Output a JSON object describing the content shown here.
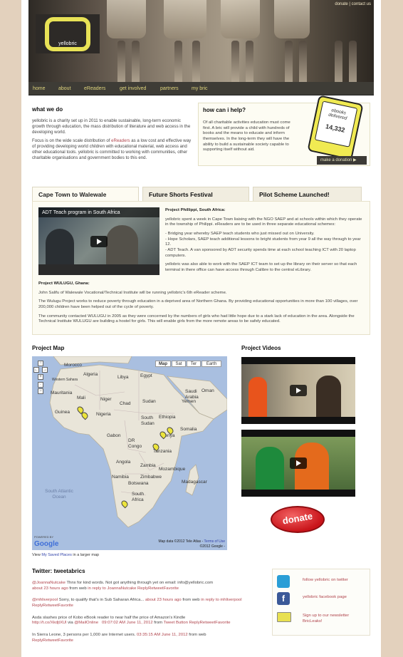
{
  "header": {
    "top_links": [
      "donate",
      "contact us"
    ],
    "top_sep": " | ",
    "logo_text": "yellobric"
  },
  "nav": {
    "items": [
      "home",
      "about",
      "eReaders",
      "get involved",
      "partners",
      "my bric"
    ]
  },
  "what_we_do": {
    "title": "what we do",
    "p1": "yellobric is a charity set up in 2011 to enable sustainable, long-term economic growth through education, the mass distribution of literature and web access in the developing world.",
    "p2_before": "Focus is on the wide scale distribution of ",
    "p2_link": "eReaders",
    "p2_after": " as a low cost and effective way of providing developing world children with educational material, web access and other educational tools. yellobric is committed to working with communities, other charitable organisations and government bodies to this end."
  },
  "how_help": {
    "title": "how can i help?",
    "text": "Of all charitable activities education must come first. A bric will provide a child with hundreds of books and the means to educate and inform themselves. In the long-term they will have the ability to build a sustainable society capable to supporting itself without aid.",
    "reader_label": "ebooks delivered",
    "reader_count": "14,332",
    "donate_button": "make a donation  ▶"
  },
  "tabs": [
    "Cape Town to Walewale",
    "Future Shorts Festival",
    "Pilot Scheme Launched!"
  ],
  "panel": {
    "video_title": "ADT Teach program in South Africa",
    "project1_title": "Project Phillippi, South Africa:",
    "project1_p1": "yellobric spent a week in Cape Town liaising with the NGO SAEP and at schools within which they operate in the township of Philippi. eReaders are to be used in three separate educational schemes:",
    "project1_list": "- Bridging year whereby SAEP teach students who just missed out on University.\n- Hope Scholars, SAEP teach additional lessons to bright students from year 9 all the way through to year 12.\n- ADT Teach. A van sponsored by ADT security spends time at each school teaching ICT with 20 laptop computers.",
    "project1_p2": "yellobric was also able to work with the SAEP ICT team to set up the library on their server so that each terminal in there office can have access through Calibre to the central eLibrary.",
    "project2_title": "Project WULUGU, Ghana:",
    "project2_p1": "John Salifu of Walewale Vocational/Technical Institute will be running yellobric's 6th eReader scheme.",
    "project2_p2": "The Wulugu Project works to reduce poverty through education in a deprived area of Northern Ghana. By providing educational opportunities in more than 100 villages, over 200,000 children have been helped out of the cycle of poverty.",
    "project2_p3": "The community contacted WULUGU in 2005 as they were concerned by the numbers of girls who had little hope due to a stark lack of education in the area. Alongside the Technical Institute WULUGU are building a hostel for girls. This will enable girls from the more remote areas to be safely educated."
  },
  "project_map": {
    "title": "Project Map",
    "buttons": [
      "Map",
      "Sat",
      "Ter",
      "Earth"
    ],
    "labels": [
      "Morocco",
      "Algeria",
      "Libya",
      "Egypt",
      "Mauritania",
      "Mali",
      "Niger",
      "Chad",
      "Sudan",
      "Guinea",
      "Nigeria",
      "Ethiopia",
      "South Sudan",
      "Somalia",
      "Kenya",
      "Gabon",
      "DR Congo",
      "Tanzania",
      "Angola",
      "Zambia",
      "Namibia",
      "Zimbabwe",
      "Mozambique",
      "Botswana",
      "Madagascar",
      "South Africa",
      "Saudi Arabia",
      "Yemen",
      "Oman",
      "South Atlantic Ocean",
      "Western Sahara"
    ],
    "copyright": "©2012 Google -",
    "map_data": "Map data ©2012 Tele Atlas - ",
    "terms": "Terms of Use",
    "google": "Google",
    "powered": "POWERED BY",
    "note_before": "View ",
    "note_link": "My Saved Places",
    "note_after": " in a larger map"
  },
  "project_videos": {
    "title": "Project Videos"
  },
  "donate_button": "donate",
  "twitter": {
    "title": "Twitter: tweetabrics",
    "tweets": [
      {
        "user": "@JoannaNutcake",
        "text": " Thnx for kind words. Not got anything through yet on email: info@yellobric.com",
        "meta": "about 23 hours ago",
        "from": " from web ",
        "reply": "in reply to JoannaNutcake ReplyRetweetFavorite"
      },
      {
        "user": "@mhliverpool",
        "text": " Sorry, to qualify that's in Sub Saharan Africa...",
        "meta": "about 23 hours ago",
        "from": " from web ",
        "reply": "in reply to mhliverpool ReplyRetweetFavorite"
      },
      {
        "user": "",
        "text": "Asda slashes price of Kobo eBook reader to near half the price of Amazon's Kindle ",
        "link": "http://t.co/XkdjtXUl",
        "via": " via ",
        "via_user": "@MailOnline",
        "meta": "09:07:02 AM June 11, 2012",
        "from": " from ",
        "reply": "Tweet Button ReplyRetweetFavorite"
      },
      {
        "user": "",
        "text": "In Sierra Leone, 3 persons per 1,000 are Internet users. ",
        "meta": "03:35:15 AM June 11, 2012",
        "from": " from web ",
        "reply": "ReplyRetweetFavorite"
      }
    ]
  },
  "social": {
    "items": [
      "follow yellobric on twitter",
      "yellobric facebook page",
      "Sign up to our newsletter BricLeaks!"
    ],
    "colors": {
      "twitter": "#2a9ed6",
      "facebook": "#3b5998",
      "newsletter": "#e8e050"
    }
  },
  "colors": {
    "accent": "#b0444c",
    "nav_text": "#dfd57d",
    "logo_yellow": "#e8e256",
    "nav_bg": "#3e3c36"
  }
}
